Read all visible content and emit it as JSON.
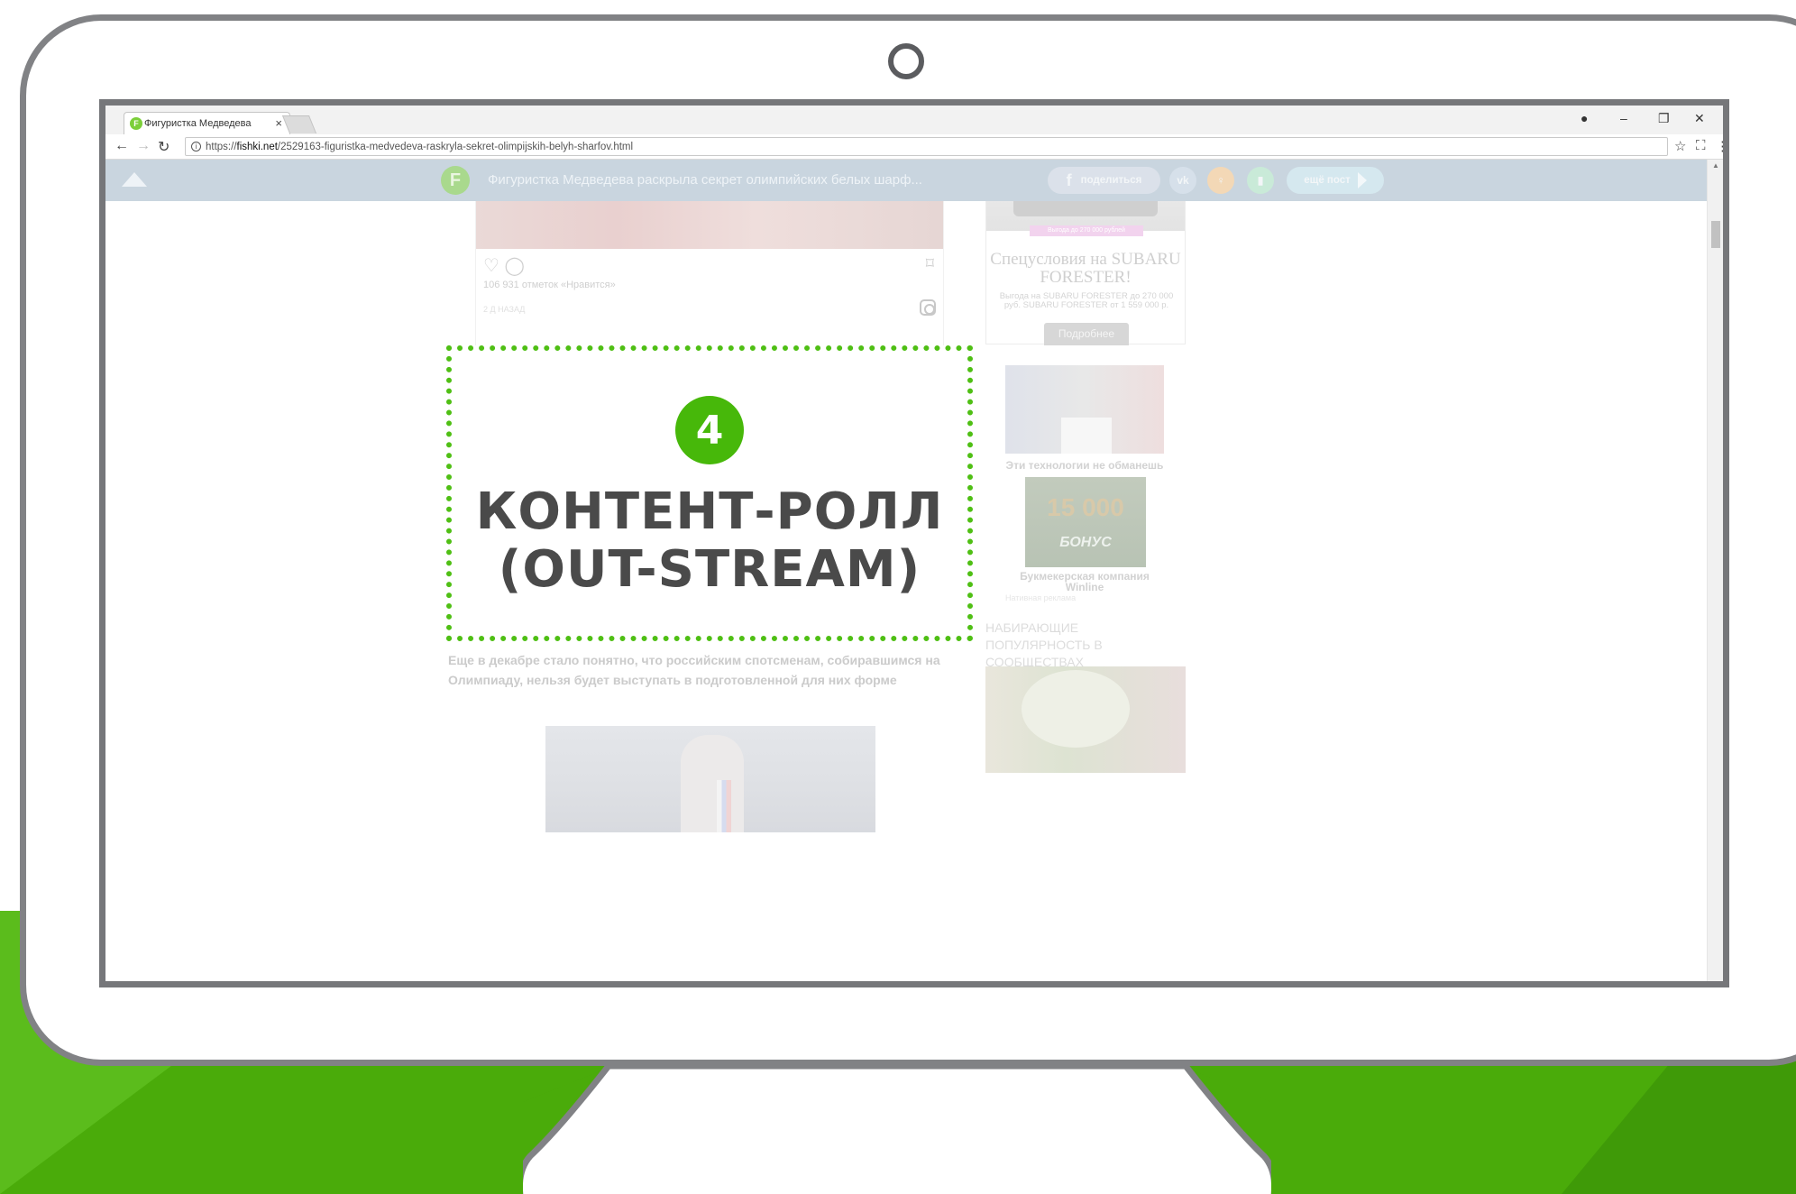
{
  "browser": {
    "tab_title": "Фигуристка Медведева",
    "tab_favicon": "F",
    "url_prefix": "https://",
    "url_host": "fishki.net",
    "url_path": "/2529163-figuristka-medvedeva-raskryla-sekret-olimpijskih-belyh-sharfov.html"
  },
  "site_header": {
    "logo": "F",
    "article_title": "Фигуристка Медведева раскрыла секрет олимпийских белых шарф...",
    "share_fb": "поделиться",
    "share_vk": "vk",
    "more_label": "ещё пост"
  },
  "instagram": {
    "likes": "106 931 отметок «Нравится»",
    "time": "2 Д НАЗАД"
  },
  "highlight": {
    "number": "4",
    "line1": "КОНТЕНТ-РОЛЛ",
    "line2": "(OUT-STREAM)",
    "accent_color": "#47b80a"
  },
  "article": {
    "text": "Еще в декабре стало понятно, что российским спотсменам, собиравшимся на Олимпиаду, нельзя будет выступать в подготовленной для них форме"
  },
  "sidebar": {
    "ad_ribbon": "Выгода до 270 000 рублей",
    "ad_title": "Спецусловия на SUBARU FORESTER!",
    "ad_desc": "Выгода на SUBARU FORESTER до 270 000 руб. SUBARU FORESTER от 1 559 000 р.",
    "ad_button": "Подробнее",
    "teaser1_caption": "Эти технологии не обманешь",
    "teaser2_number": "15 000",
    "teaser2_bonus": "БОНУС",
    "teaser2_caption": "Букмекерская компания Winline",
    "ad_label": "Нативная реклама",
    "section_heading": "НАБИРАЮЩИЕ ПОПУЛЯРНОСТЬ В СООБЩЕСТВАХ"
  },
  "icons": {
    "back": "back-arrow-icon",
    "forward": "forward-arrow-icon",
    "reload": "reload-icon",
    "star": "star-icon",
    "menu": "kebab-menu-icon"
  }
}
